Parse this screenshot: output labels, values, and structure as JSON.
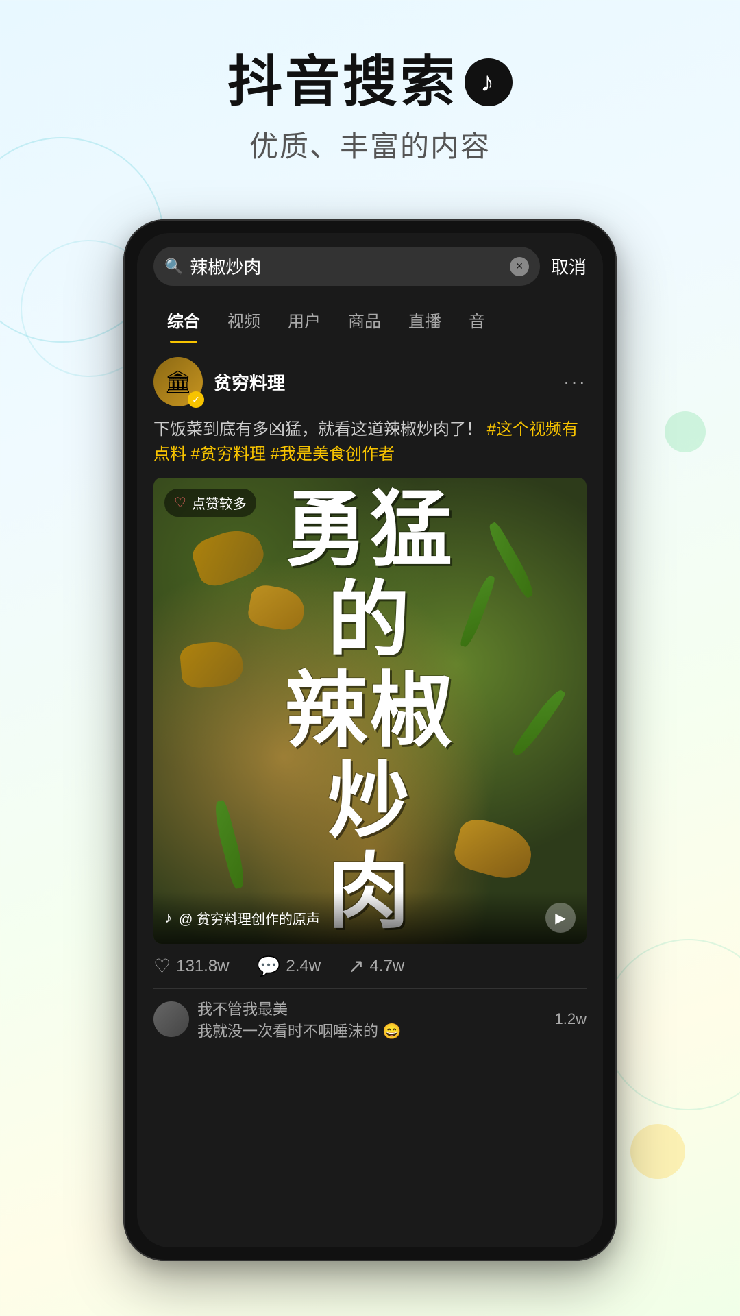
{
  "background": {
    "color_top": "#e8f8ff",
    "color_bottom": "#f0ffe8"
  },
  "header": {
    "title": "抖音搜索",
    "logo_symbol": "♪",
    "subtitle": "优质、丰富的内容"
  },
  "phone": {
    "search_bar": {
      "search_icon": "🔍",
      "query": "辣椒炒肉",
      "clear_icon": "×",
      "cancel_label": "取消"
    },
    "tabs": [
      {
        "label": "综合",
        "active": true
      },
      {
        "label": "视频",
        "active": false
      },
      {
        "label": "用户",
        "active": false
      },
      {
        "label": "商品",
        "active": false
      },
      {
        "label": "直播",
        "active": false
      },
      {
        "label": "音",
        "active": false
      }
    ],
    "post": {
      "user_name": "贫穷料理",
      "user_avatar_emoji": "🏛",
      "more_icon": "···",
      "post_text": "下饭菜到底有多凶猛，就看这道辣椒炒肉了！",
      "hashtags": "#这个视频有点料 #贫穷料理 #我是美食创作者",
      "video": {
        "badge_heart": "♡",
        "badge_text": "点赞较多",
        "overlay_text": "勇猛的辣椒炒肉",
        "sound_label": "@ 贫穷料理创作的原声",
        "play_icon": "▶"
      },
      "engagement": {
        "likes": "131.8w",
        "comments": "2.4w",
        "shares": "4.7w"
      },
      "comments": [
        {
          "user": "我不管我最美",
          "text": "我就没一次看时不咽唾沫的 😄",
          "count": "1.2w"
        }
      ]
    }
  }
}
